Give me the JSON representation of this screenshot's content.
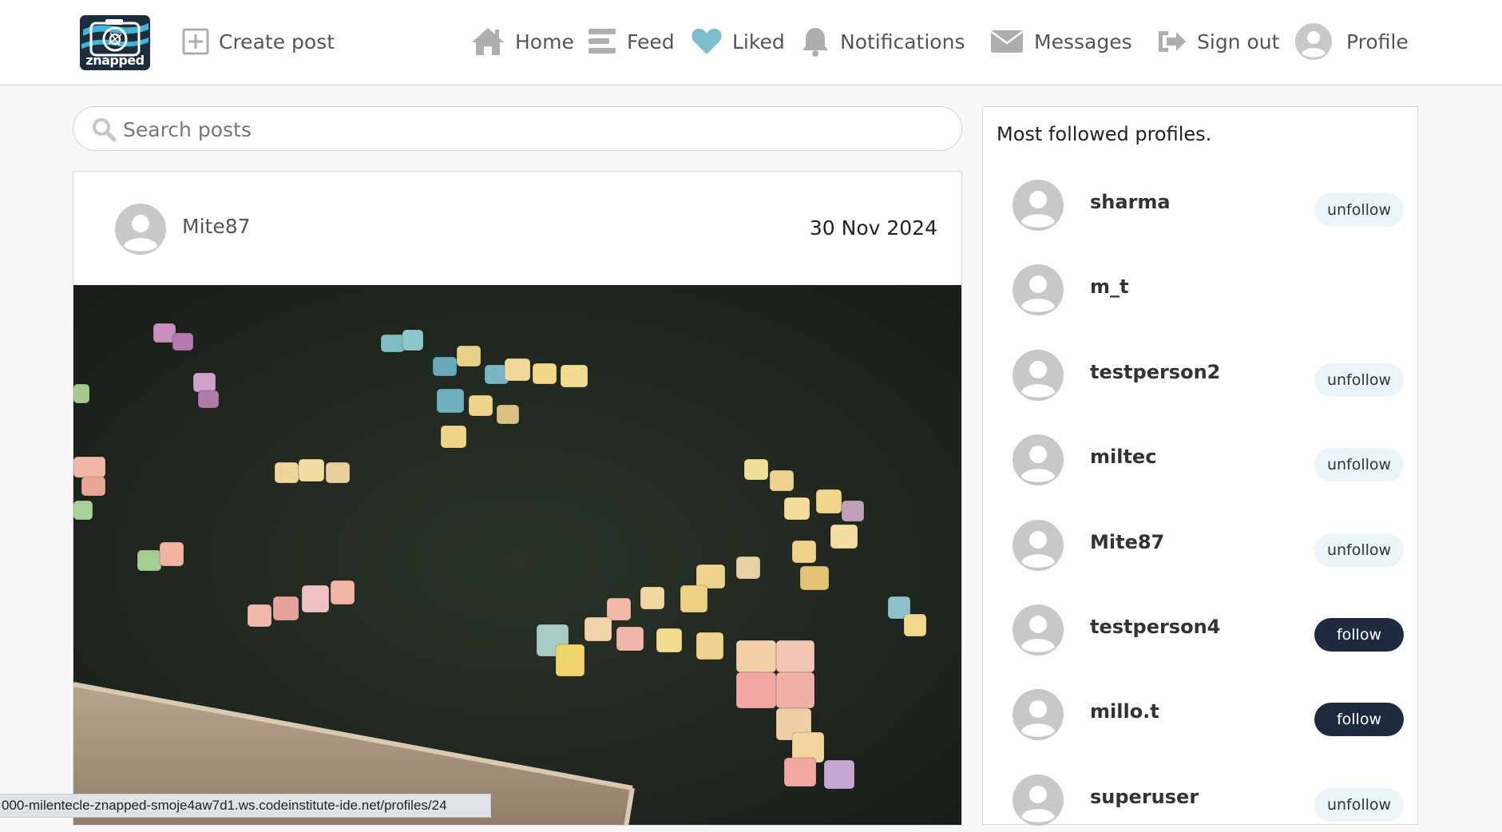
{
  "app": {
    "logo_text": "znapped"
  },
  "nav": {
    "create_post": "Create post",
    "home": "Home",
    "feed": "Feed",
    "liked": "Liked",
    "notifications": "Notifications",
    "messages": "Messages",
    "sign_out": "Sign out",
    "profile": "Profile"
  },
  "search": {
    "placeholder": "Search posts",
    "value": ""
  },
  "post": {
    "author": "Mite87",
    "date": "30 Nov 2024"
  },
  "sidebar": {
    "title": "Most followed profiles.",
    "profiles": [
      {
        "name": "sharma",
        "action": "unfollow"
      },
      {
        "name": "m_t",
        "action": ""
      },
      {
        "name": "testperson2",
        "action": "unfollow"
      },
      {
        "name": "miltec",
        "action": "unfollow"
      },
      {
        "name": "Mite87",
        "action": "unfollow"
      },
      {
        "name": "testperson4",
        "action": "follow"
      },
      {
        "name": "millo.t",
        "action": "follow"
      },
      {
        "name": "superuser",
        "action": "unfollow"
      }
    ]
  },
  "status_bar": {
    "url": "000-milentecle-znapped-smoje4aw7d1.ws.codeinstitute-ide.net/profiles/24"
  },
  "colors": {
    "brand_dark": "#1e2a3e",
    "unfollow_bg": "#eaf4f9",
    "liked_heart": "#7bbfcf",
    "nav_icon": "#aeaeae"
  }
}
